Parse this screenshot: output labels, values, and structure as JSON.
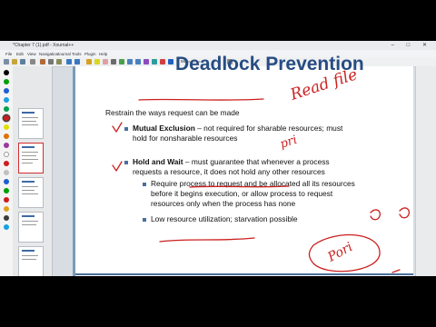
{
  "window": {
    "title": "*Chapter 7 (1).pdf - Xournal++",
    "controls": "– □ ✕"
  },
  "menu": {
    "items": [
      "File",
      "Edit",
      "View",
      "Navigation",
      "Journal",
      "Tools",
      "Plugin",
      "Help"
    ]
  },
  "toolbar": {
    "zoom_text": "96 ▭ ▭ ▭"
  },
  "colors": {
    "title": "#274c82",
    "accent": "#4a6f9c",
    "ink_red": "#cc1f1f",
    "pen_palette": [
      "#000000",
      "#00a000",
      "#1e5fd0",
      "#19a0e0",
      "#e0e000",
      "#e07000",
      "#d01c1c",
      "#9a3aa0",
      "#c0c0c0",
      "#ffffff"
    ]
  },
  "slide": {
    "title": "Deadlock Prevention",
    "intro": "Restrain the ways request can be made",
    "b1_bold": "Mutual Exclusion",
    "b1_rest": " – not required for sharable resources; must",
    "b1_line2": "hold for nonsharable resources",
    "b2_bold": "Hold and Wait",
    "b2_rest": " – must guarantee that whenever a process",
    "b2_line2": "requests a resource, it does not hold any other resources",
    "s1_l1": "Require process to request and be allocated all its resources",
    "s1_l2": "before it begins execution, or allow process to request",
    "s1_l3": "resources only when the process has none",
    "s2": "Low resource utilization; starvation possible"
  },
  "annotations": {
    "handwriting_1": "Read file",
    "handwriting_2": "pri",
    "handwriting_3": "Pori"
  }
}
